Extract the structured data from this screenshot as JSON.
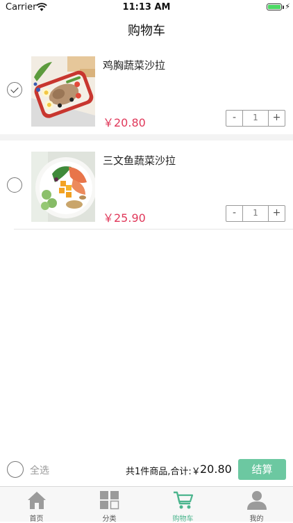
{
  "status_bar": {
    "carrier": "Carrier",
    "time": "11:13 AM"
  },
  "nav": {
    "title": "购物车"
  },
  "cart": {
    "items": [
      {
        "name": "鸡胸蔬菜沙拉",
        "price": "￥20.80",
        "quantity": "1",
        "checked": true,
        "image": "chicken-salad"
      },
      {
        "name": "三文鱼蔬菜沙拉",
        "price": "￥25.90",
        "quantity": "1",
        "checked": false,
        "image": "salmon-salad"
      }
    ],
    "stepper": {
      "minus": "-",
      "plus": "+"
    }
  },
  "checkout": {
    "select_all_label": "全选",
    "summary": "共1件商品,合计:￥",
    "total": "20.80",
    "button_label": "结算"
  },
  "tab_bar": {
    "tabs": [
      {
        "label": "首页",
        "icon": "home-icon"
      },
      {
        "label": "分类",
        "icon": "category-grid-icon"
      },
      {
        "label": "购物车",
        "icon": "cart-icon",
        "active": true
      },
      {
        "label": "我的",
        "icon": "person-icon"
      }
    ]
  },
  "colors": {
    "accent": "#6cc8a1",
    "price": "#e0385a",
    "tab_active": "#4cb58e"
  }
}
